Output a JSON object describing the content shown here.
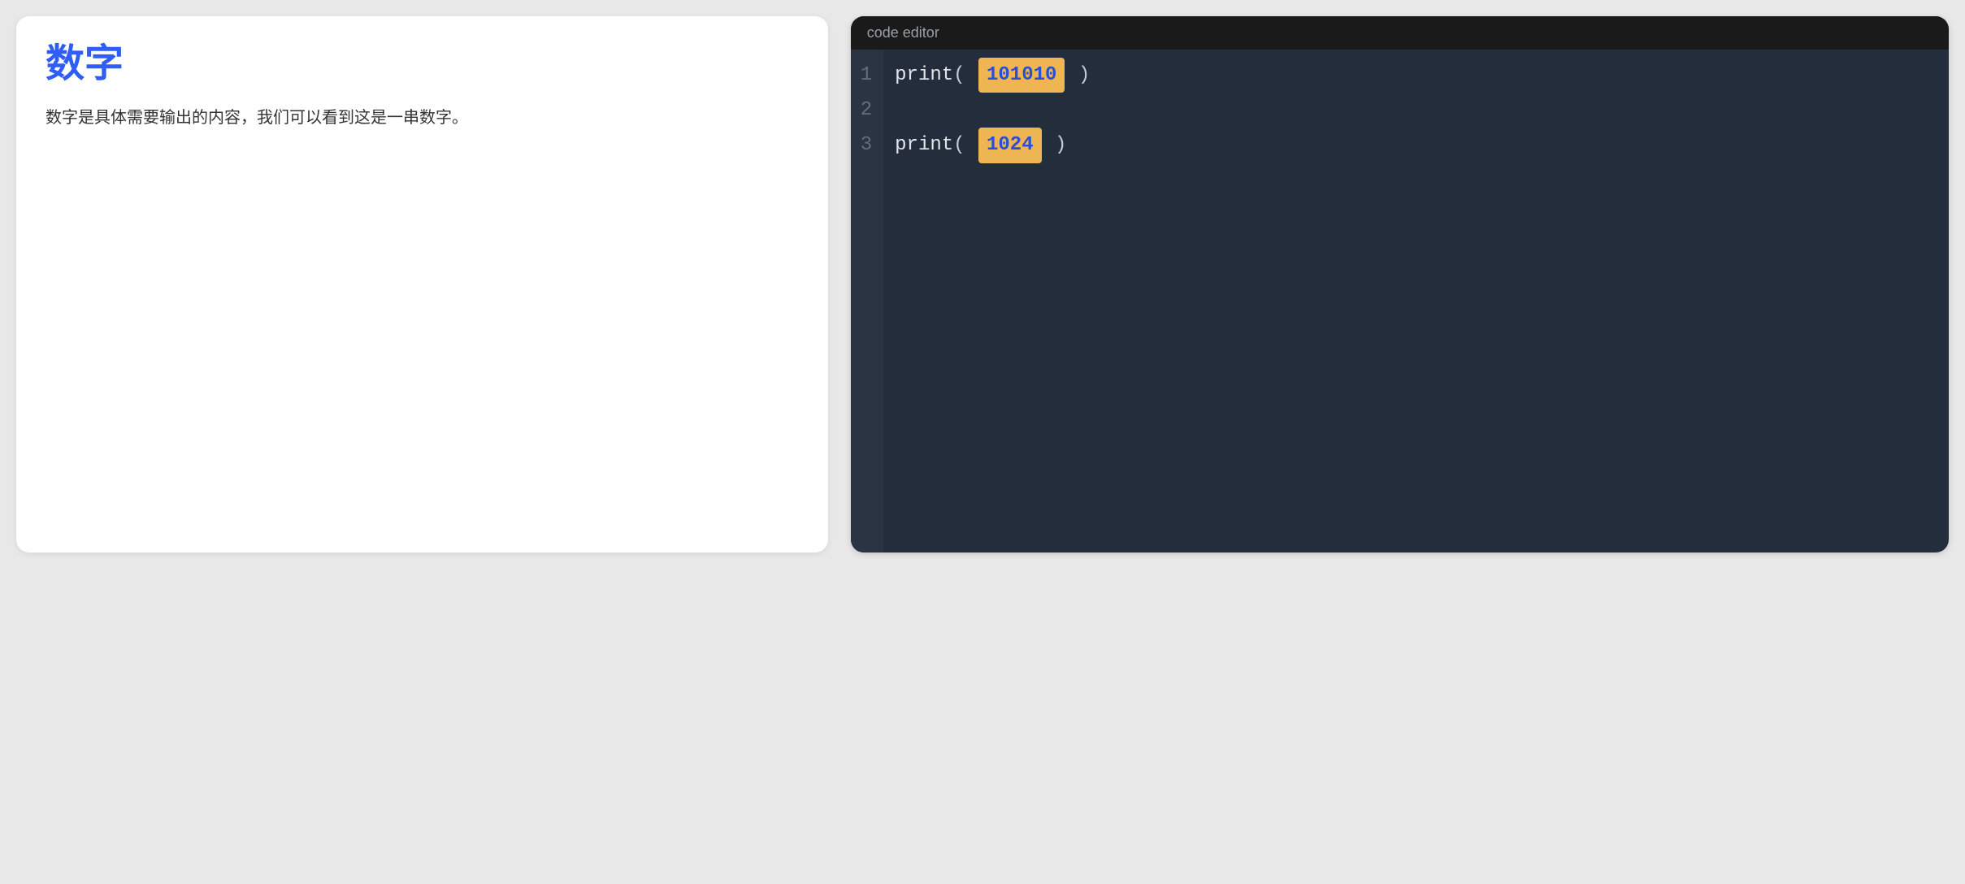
{
  "lesson": {
    "title": "数字",
    "body": "数字是具体需要输出的内容，我们可以看到这是一串数字。"
  },
  "editor": {
    "header_label": "code editor",
    "lines": [
      {
        "lineno": "1",
        "tokens": [
          {
            "kind": "fn",
            "text": "print"
          },
          {
            "kind": "punc",
            "text": "("
          },
          {
            "kind": "space",
            "text": " "
          },
          {
            "kind": "numhl",
            "text": "101010"
          },
          {
            "kind": "space",
            "text": " "
          },
          {
            "kind": "punc",
            "text": ")"
          }
        ]
      },
      {
        "lineno": "2",
        "tokens": []
      },
      {
        "lineno": "3",
        "tokens": [
          {
            "kind": "fn",
            "text": "print"
          },
          {
            "kind": "punc",
            "text": "("
          },
          {
            "kind": "space",
            "text": " "
          },
          {
            "kind": "numhl",
            "text": "1024"
          },
          {
            "kind": "space",
            "text": " "
          },
          {
            "kind": "punc",
            "text": ")"
          }
        ]
      }
    ]
  }
}
